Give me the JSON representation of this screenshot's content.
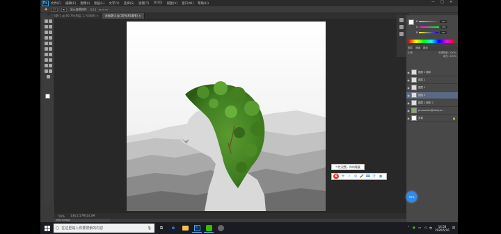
{
  "window": {
    "menus": [
      "文件(F)",
      "编辑(E)",
      "图像(I)",
      "图层(L)",
      "文字(Y)",
      "选择(S)",
      "滤镜(T)",
      "3D(D)",
      "视图(V)",
      "窗口(W)",
      "帮助(H)"
    ],
    "controls": [
      "—",
      "□",
      "✕"
    ]
  },
  "options_bar": {
    "items": [
      "显示变换控件"
    ]
  },
  "tabs": [
    {
      "label": "未标题-1 @ 66.7%(图层 1, RGB/8) ×",
      "active": false
    },
    {
      "label": "未标题-2 @ 50%(RGB/8) ×",
      "active": true
    }
  ],
  "color_panel": {
    "sliders": [
      {
        "label": "R",
        "value": "255",
        "color": "#e04040"
      },
      {
        "label": "G",
        "value": "255",
        "color": "#40c040"
      },
      {
        "label": "B",
        "value": "255",
        "color": "#4060e0"
      }
    ]
  },
  "layers_panel": {
    "tabs": [
      "图层",
      "通道",
      "路径"
    ],
    "blend_mode": "正常",
    "opacity_label": "不透明度: 100%",
    "fill_label": "填充: 100%",
    "layers": [
      {
        "name": "图层 1 副本",
        "selected": false
      },
      {
        "name": "图层 2",
        "selected": false
      },
      {
        "name": "图层 1",
        "selected": false
      },
      {
        "name": "图层 3",
        "selected": true
      },
      {
        "name": "图层 1 副本 2",
        "selected": false
      },
      {
        "name": "promotion@daily.ac...",
        "selected": false
      },
      {
        "name": "背景",
        "selected": false
      }
    ]
  },
  "status_bar": {
    "zoom": "50%",
    "doc_info": "文档:2.57M/14.3M"
  },
  "timeline_label": "Mini Bridge",
  "ime": {
    "tooltip": "个性设置，你的最爱",
    "toolbar_logo": "S",
    "toolbar_icons": [
      "中",
      "ノ",
      "☺",
      "🎤",
      "⌨",
      "👕",
      "▦"
    ]
  },
  "float_ball": {
    "label": "55%"
  },
  "taskbar": {
    "search_placeholder": "在这里输入你要搜索的内容",
    "clock_time": "14:58",
    "clock_date": "2020/5/16",
    "tray_text": "中"
  }
}
